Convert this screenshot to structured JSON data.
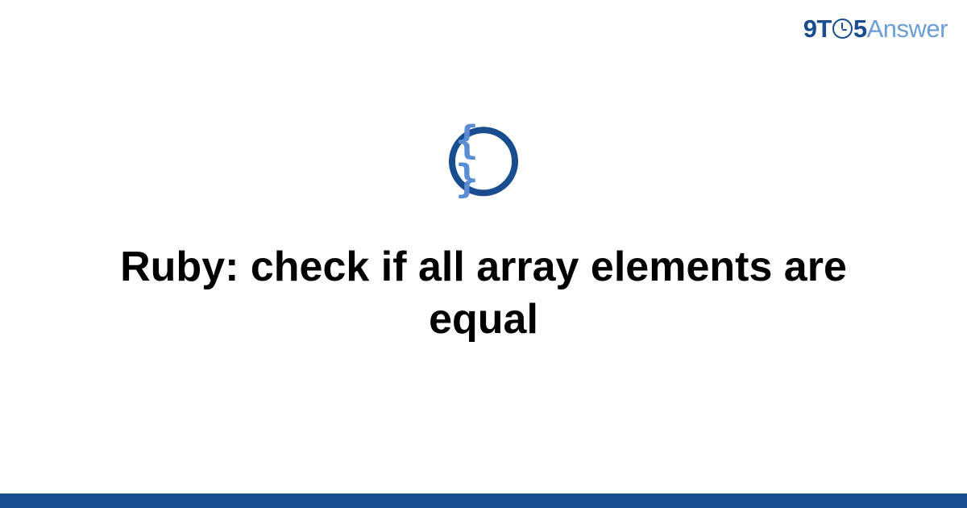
{
  "logo": {
    "part1": "9T",
    "part2": "5",
    "part3": "Answer"
  },
  "icon": {
    "name": "code-braces-icon",
    "glyph": "{ }"
  },
  "title": "Ruby: check if all array elements are equal",
  "colors": {
    "brand_dark": "#1a4d8f",
    "brand_light": "#6b9dd6"
  }
}
